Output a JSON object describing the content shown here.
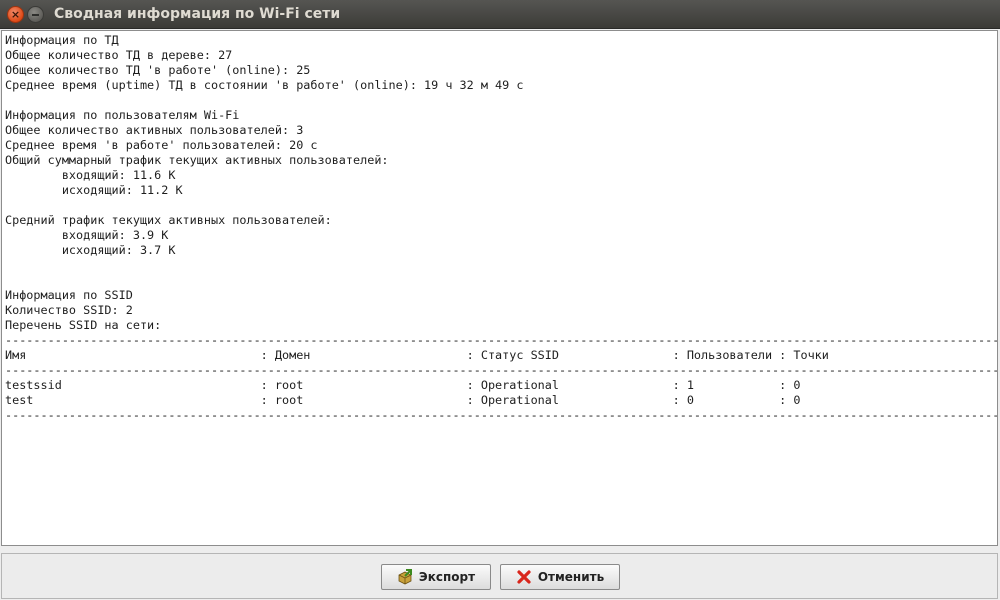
{
  "window": {
    "title": "Сводная информация по Wi-Fi сети",
    "close_glyph": "×"
  },
  "report": {
    "text": "Информация по ТД\nОбщее количество ТД в дереве: 27\nОбщее количество ТД 'в работе' (online): 25\nСреднее время (uptime) ТД в состоянии 'в работе' (online): 19 ч 32 м 49 с\n\nИнформация по пользователям Wi-Fi\nОбщее количество активных пользователей: 3\nСреднее время 'в работе' пользователей: 20 с\nОбщий суммарный трафик текущих активных пользователей:\n\tвходящий: 11.6 K\n\tисходящий: 11.2 K\n\nСредний трафик текущих активных пользователей:\n\tвходящий: 3.9 K\n\tисходящий: 3.7 K\n\n\nИнформация по SSID\nКоличество SSID: 2\nПеречень SSID на сети:\n--------------------------------------------------------------------------------------------------------------------------------------------\nИмя                                 : Домен                      : Статус SSID                : Пользователи : Точки\n--------------------------------------------------------------------------------------------------------------------------------------------\ntestssid                            : root                       : Operational                : 1            : 0\ntest                                : root                       : Operational                : 0            : 0\n--------------------------------------------------------------------------------------------------------------------------------------------"
  },
  "buttons": {
    "export_label": "Экспорт",
    "cancel_label": "Отменить"
  },
  "icons": {
    "export": "export-icon",
    "cancel": "cancel-icon"
  },
  "colors": {
    "titlebar": "#3c3b37",
    "close_button": "#df4a16",
    "cancel_x": "#d9261c"
  }
}
